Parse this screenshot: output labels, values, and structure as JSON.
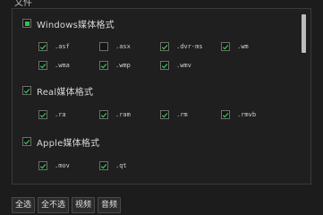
{
  "window": {
    "title": "文件"
  },
  "groups": [
    {
      "label": "Windows媒体格式",
      "state": "partial",
      "items": [
        {
          "label": ".asf",
          "checked": true
        },
        {
          "label": ".asx",
          "checked": false
        },
        {
          "label": ".dvr-ms",
          "checked": true
        },
        {
          "label": ".wm",
          "checked": true
        },
        {
          "label": ".wma",
          "checked": true
        },
        {
          "label": ".wmp",
          "checked": true
        },
        {
          "label": ".wmv",
          "checked": true
        }
      ]
    },
    {
      "label": "Real媒体格式",
      "state": "checked",
      "items": [
        {
          "label": ".ra",
          "checked": true
        },
        {
          "label": ".ram",
          "checked": true
        },
        {
          "label": ".rm",
          "checked": true
        },
        {
          "label": ".rmvb",
          "checked": true
        }
      ]
    },
    {
      "label": "Apple媒体格式",
      "state": "checked",
      "items": [
        {
          "label": ".mov",
          "checked": true
        },
        {
          "label": ".qt",
          "checked": true
        }
      ]
    }
  ],
  "buttons": [
    "全选",
    "全不选",
    "视频",
    "音频"
  ],
  "colors": {
    "check": "#2fc24a",
    "background": "#1c1c1c",
    "border": "#3a3a3a"
  }
}
